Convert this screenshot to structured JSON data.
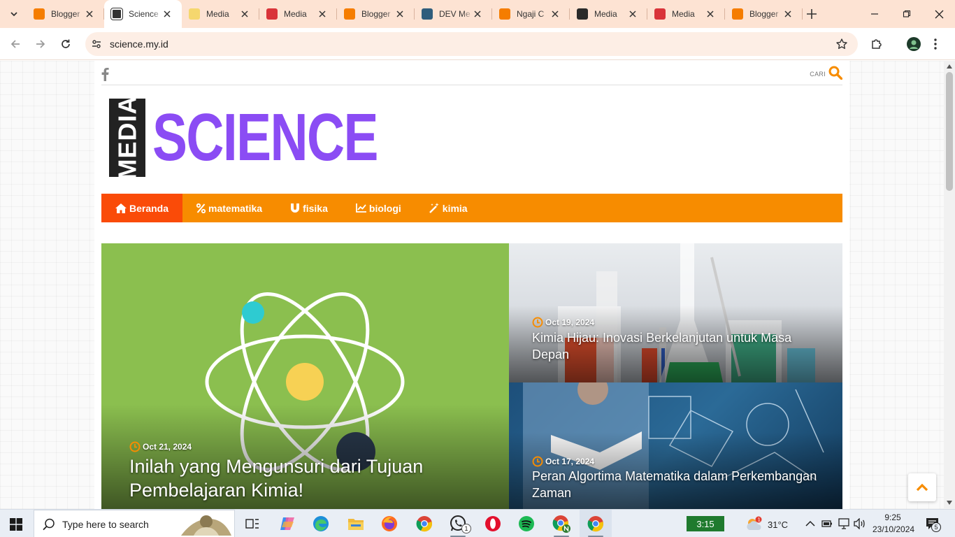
{
  "browser": {
    "tabs": [
      {
        "title": "Blogger",
        "favicon": "blogger-icon",
        "color": "#f57d00"
      },
      {
        "title": "Science",
        "favicon": "science-logo-icon",
        "color": "#333333",
        "active": true
      },
      {
        "title": "Media",
        "favicon": "media-icon",
        "color": "#f5d76e"
      },
      {
        "title": "Media",
        "favicon": "media-red-icon",
        "color": "#d9343a"
      },
      {
        "title": "Blogger",
        "favicon": "blogger-icon",
        "color": "#f57d00"
      },
      {
        "title": "DEV Me",
        "favicon": "dev-icon",
        "color": "#2f5d7c"
      },
      {
        "title": "Ngaji C",
        "favicon": "blogger-icon",
        "color": "#f57d00"
      },
      {
        "title": "Media",
        "favicon": "media-dark-icon",
        "color": "#2a2a2a"
      },
      {
        "title": "Media",
        "favicon": "media-red-icon",
        "color": "#d9343a"
      },
      {
        "title": "Blogger",
        "favicon": "blogger-icon",
        "color": "#f57d00"
      }
    ],
    "url": "science.my.id"
  },
  "site": {
    "search_label": "CARI",
    "logo_word1": "MEDIA",
    "logo_word2": "SCIENCE",
    "accent_color": "#f78c00",
    "active_color": "#fa4b08",
    "logo_color": "#8b4cf4",
    "nav": [
      {
        "label": "Beranda",
        "icon": "home-icon",
        "active": true
      },
      {
        "label": "matematika",
        "icon": "percent-icon"
      },
      {
        "label": "fisika",
        "icon": "magnet-icon"
      },
      {
        "label": "biologi",
        "icon": "line-chart-icon"
      },
      {
        "label": "kimia",
        "icon": "magic-wand-icon"
      }
    ]
  },
  "featured": [
    {
      "date": "Oct 21, 2024",
      "title": "Inilah yang Mengunsuri dari Tujuan Pembelajaran Kimia!"
    },
    {
      "date": "Oct 19, 2024",
      "title": "Kimia Hijau: Inovasi Berkelanjutan untuk Masa Depan"
    },
    {
      "date": "Oct 17, 2024",
      "title": "Peran Algortima Matematika dalam Perkembangan Zaman"
    }
  ],
  "taskbar": {
    "search_placeholder": "Type here to search",
    "timer": "3:15",
    "temperature": "31°C",
    "time": "9:25",
    "date": "23/10/2024",
    "whatsapp_badge": "1",
    "notification_count": "5"
  }
}
